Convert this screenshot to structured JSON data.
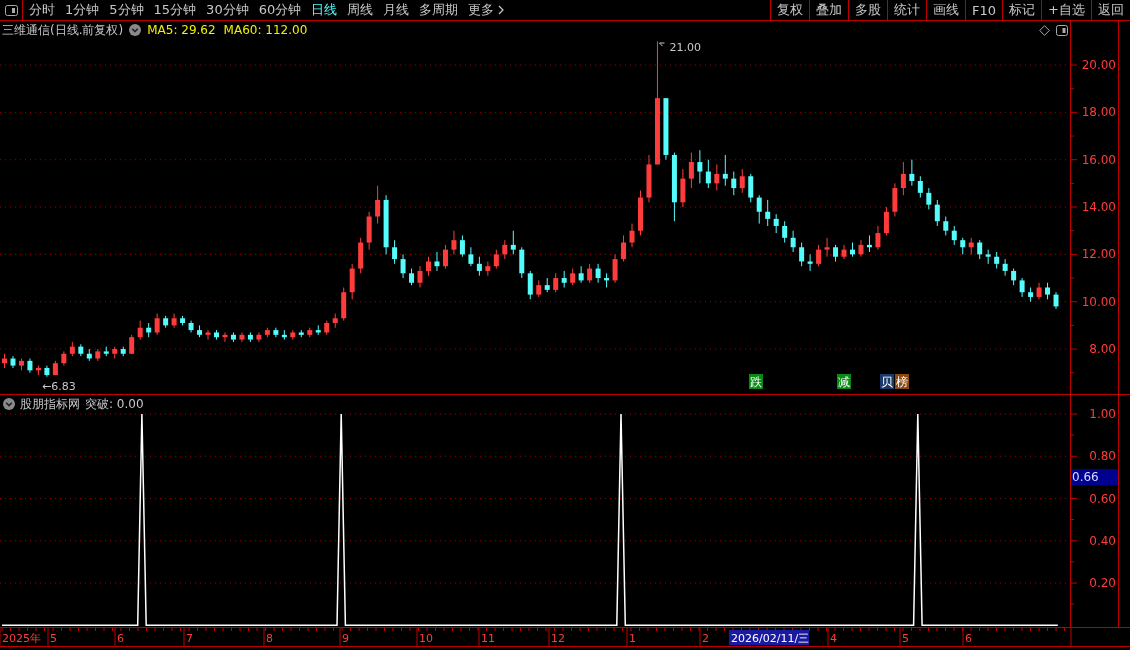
{
  "toolbar": {
    "periods": [
      {
        "label": "分时",
        "selected": false
      },
      {
        "label": "1分钟",
        "selected": false
      },
      {
        "label": "5分钟",
        "selected": false
      },
      {
        "label": "15分钟",
        "selected": false
      },
      {
        "label": "30分钟",
        "selected": false
      },
      {
        "label": "60分钟",
        "selected": false
      },
      {
        "label": "日线",
        "selected": true
      },
      {
        "label": "周线",
        "selected": false
      },
      {
        "label": "月线",
        "selected": false
      },
      {
        "label": "多周期",
        "selected": false
      },
      {
        "label": "更多",
        "selected": false
      }
    ],
    "actions": [
      "复权",
      "叠加",
      "多股",
      "统计",
      "画线",
      "F10",
      "标记",
      "+自选",
      "返回"
    ]
  },
  "price_chart": {
    "title": "三维通信(日线.前复权)",
    "indicators": [
      {
        "label": "MA5: 29.62"
      },
      {
        "label": "MA60: 112.00"
      }
    ],
    "low_label": "←6.83",
    "high_label": "21.00",
    "signals": [
      {
        "label": "跌",
        "color": "#0a8a14"
      },
      {
        "label": "减",
        "color": "#0a8a14"
      },
      {
        "label": "贝",
        "color": "#1a3a6a"
      },
      {
        "label": "榜",
        "color": "#8a4a12"
      }
    ],
    "chart_data": {
      "type": "candlestick",
      "ylim": [
        6.1,
        21.1
      ],
      "grid": true,
      "yticks": [
        {
          "value": 20,
          "label": "20.00"
        },
        {
          "value": 18,
          "label": "18.00"
        },
        {
          "value": 16,
          "label": "16.00"
        },
        {
          "value": 14,
          "label": "14.00"
        },
        {
          "value": 12,
          "label": "12.00"
        },
        {
          "value": 10,
          "label": "10.00"
        },
        {
          "value": 8,
          "label": "8.00"
        }
      ],
      "ohlc": [
        [
          7.4,
          7.8,
          7.2,
          7.6
        ],
        [
          7.6,
          7.7,
          7.2,
          7.3
        ],
        [
          7.3,
          7.6,
          7.1,
          7.5
        ],
        [
          7.5,
          7.6,
          7.0,
          7.1
        ],
        [
          7.1,
          7.3,
          6.9,
          7.2
        ],
        [
          7.2,
          7.3,
          6.83,
          6.9
        ],
        [
          6.9,
          7.5,
          6.9,
          7.4
        ],
        [
          7.4,
          7.9,
          7.3,
          7.8
        ],
        [
          7.8,
          8.3,
          7.7,
          8.1
        ],
        [
          8.1,
          8.2,
          7.7,
          7.8
        ],
        [
          7.8,
          8.0,
          7.5,
          7.6
        ],
        [
          7.6,
          8.0,
          7.5,
          7.9
        ],
        [
          7.9,
          8.1,
          7.7,
          7.8
        ],
        [
          7.8,
          8.1,
          7.6,
          8.0
        ],
        [
          8.0,
          8.1,
          7.7,
          7.8
        ],
        [
          7.8,
          8.6,
          7.8,
          8.5
        ],
        [
          8.5,
          9.2,
          8.4,
          8.9
        ],
        [
          8.9,
          9.1,
          8.5,
          8.7
        ],
        [
          8.7,
          9.5,
          8.6,
          9.3
        ],
        [
          9.3,
          9.4,
          8.9,
          9.0
        ],
        [
          9.0,
          9.5,
          8.9,
          9.3
        ],
        [
          9.3,
          9.4,
          9.0,
          9.1
        ],
        [
          9.1,
          9.2,
          8.7,
          8.8
        ],
        [
          8.8,
          9.0,
          8.5,
          8.6
        ],
        [
          8.6,
          8.8,
          8.4,
          8.7
        ],
        [
          8.7,
          8.8,
          8.4,
          8.5
        ],
        [
          8.5,
          8.7,
          8.3,
          8.6
        ],
        [
          8.6,
          8.7,
          8.3,
          8.4
        ],
        [
          8.4,
          8.7,
          8.3,
          8.6
        ],
        [
          8.6,
          8.7,
          8.3,
          8.4
        ],
        [
          8.4,
          8.7,
          8.3,
          8.6
        ],
        [
          8.6,
          8.9,
          8.5,
          8.8
        ],
        [
          8.8,
          8.9,
          8.5,
          8.6
        ],
        [
          8.6,
          8.8,
          8.4,
          8.5
        ],
        [
          8.5,
          8.8,
          8.4,
          8.7
        ],
        [
          8.7,
          8.8,
          8.5,
          8.6
        ],
        [
          8.6,
          8.9,
          8.5,
          8.8
        ],
        [
          8.8,
          9.0,
          8.6,
          8.7
        ],
        [
          8.7,
          9.2,
          8.6,
          9.1
        ],
        [
          9.1,
          9.5,
          8.9,
          9.3
        ],
        [
          9.3,
          10.6,
          9.2,
          10.4
        ],
        [
          10.4,
          11.6,
          10.1,
          11.4
        ],
        [
          11.4,
          12.7,
          11.2,
          12.5
        ],
        [
          12.5,
          13.8,
          12.2,
          13.6
        ],
        [
          13.6,
          14.9,
          13.3,
          14.3
        ],
        [
          14.3,
          14.5,
          12.0,
          12.3
        ],
        [
          12.3,
          12.6,
          11.6,
          11.8
        ],
        [
          11.8,
          12.0,
          11.0,
          11.2
        ],
        [
          11.2,
          11.4,
          10.7,
          10.8
        ],
        [
          10.8,
          11.5,
          10.6,
          11.3
        ],
        [
          11.3,
          11.9,
          11.1,
          11.7
        ],
        [
          11.7,
          12.1,
          11.3,
          11.5
        ],
        [
          11.5,
          12.4,
          11.4,
          12.2
        ],
        [
          12.2,
          13.0,
          12.0,
          12.6
        ],
        [
          12.6,
          12.8,
          11.9,
          12.0
        ],
        [
          12.0,
          12.3,
          11.5,
          11.6
        ],
        [
          11.6,
          11.9,
          11.1,
          11.3
        ],
        [
          11.3,
          11.7,
          11.1,
          11.5
        ],
        [
          11.5,
          12.2,
          11.4,
          12.0
        ],
        [
          12.0,
          12.6,
          11.8,
          12.4
        ],
        [
          12.4,
          13.0,
          12.0,
          12.2
        ],
        [
          12.2,
          12.3,
          11.0,
          11.2
        ],
        [
          11.2,
          11.3,
          10.1,
          10.3
        ],
        [
          10.3,
          10.9,
          10.2,
          10.7
        ],
        [
          10.7,
          11.0,
          10.4,
          10.5
        ],
        [
          10.5,
          11.2,
          10.4,
          11.0
        ],
        [
          11.0,
          11.3,
          10.6,
          10.8
        ],
        [
          10.8,
          11.4,
          10.7,
          11.2
        ],
        [
          11.2,
          11.5,
          10.8,
          10.9
        ],
        [
          10.9,
          11.6,
          10.8,
          11.4
        ],
        [
          11.4,
          11.6,
          10.8,
          11.0
        ],
        [
          11.0,
          11.2,
          10.6,
          10.9
        ],
        [
          10.9,
          12.0,
          10.8,
          11.8
        ],
        [
          11.8,
          12.8,
          11.7,
          12.5
        ],
        [
          12.5,
          13.3,
          12.3,
          13.0
        ],
        [
          13.0,
          14.7,
          12.8,
          14.4
        ],
        [
          14.4,
          16.2,
          14.2,
          15.8
        ],
        [
          15.8,
          21.0,
          15.8,
          18.6
        ],
        [
          18.6,
          18.6,
          16.0,
          16.2
        ],
        [
          16.2,
          16.3,
          13.4,
          14.2
        ],
        [
          14.2,
          15.6,
          14.0,
          15.2
        ],
        [
          15.2,
          16.3,
          14.8,
          15.9
        ],
        [
          15.9,
          16.4,
          15.0,
          15.5
        ],
        [
          15.5,
          16.0,
          14.8,
          15.0
        ],
        [
          15.0,
          15.8,
          14.7,
          15.4
        ],
        [
          15.4,
          16.2,
          14.9,
          15.2
        ],
        [
          15.2,
          15.5,
          14.5,
          14.8
        ],
        [
          14.8,
          15.6,
          14.6,
          15.3
        ],
        [
          15.3,
          15.4,
          14.2,
          14.4
        ],
        [
          14.4,
          14.5,
          13.3,
          13.8
        ],
        [
          13.8,
          14.3,
          13.2,
          13.5
        ],
        [
          13.5,
          13.7,
          12.9,
          13.2
        ],
        [
          13.2,
          13.4,
          12.5,
          12.7
        ],
        [
          12.7,
          13.0,
          12.1,
          12.3
        ],
        [
          12.3,
          12.5,
          11.5,
          11.7
        ],
        [
          11.7,
          12.0,
          11.3,
          11.6
        ],
        [
          11.6,
          12.4,
          11.5,
          12.2
        ],
        [
          12.2,
          12.7,
          11.9,
          12.3
        ],
        [
          12.3,
          12.4,
          11.7,
          11.9
        ],
        [
          11.9,
          12.4,
          11.8,
          12.2
        ],
        [
          12.2,
          12.5,
          11.9,
          12.0
        ],
        [
          12.0,
          12.6,
          11.9,
          12.4
        ],
        [
          12.4,
          12.8,
          12.1,
          12.3
        ],
        [
          12.3,
          13.2,
          12.2,
          12.9
        ],
        [
          12.9,
          14.0,
          12.8,
          13.8
        ],
        [
          13.8,
          15.0,
          13.6,
          14.8
        ],
        [
          14.8,
          15.9,
          14.5,
          15.4
        ],
        [
          15.4,
          16.0,
          14.9,
          15.1
        ],
        [
          15.1,
          15.3,
          14.4,
          14.6
        ],
        [
          14.6,
          14.8,
          13.9,
          14.1
        ],
        [
          14.1,
          14.3,
          13.2,
          13.4
        ],
        [
          13.4,
          13.6,
          12.8,
          13.0
        ],
        [
          13.0,
          13.2,
          12.4,
          12.6
        ],
        [
          12.6,
          12.7,
          12.0,
          12.3
        ],
        [
          12.3,
          12.7,
          12.0,
          12.5
        ],
        [
          12.5,
          12.6,
          11.8,
          12.0
        ],
        [
          12.0,
          12.2,
          11.6,
          11.9
        ],
        [
          11.9,
          12.1,
          11.4,
          11.6
        ],
        [
          11.6,
          11.8,
          11.1,
          11.3
        ],
        [
          11.3,
          11.4,
          10.7,
          10.9
        ],
        [
          10.9,
          11.0,
          10.2,
          10.4
        ],
        [
          10.4,
          10.6,
          10.0,
          10.2
        ],
        [
          10.2,
          10.8,
          10.1,
          10.6
        ],
        [
          10.6,
          10.8,
          10.1,
          10.3
        ],
        [
          10.3,
          10.4,
          9.7,
          9.8
        ]
      ]
    }
  },
  "signal_panel": {
    "title": "股朋指标网",
    "reading": "突破: 0.00",
    "cursor_value": "0.66",
    "chart_data": {
      "type": "line",
      "ylim": [
        -0.008,
        1.09
      ],
      "grid": true,
      "yticks": [
        {
          "value": 1,
          "label": "1.00"
        },
        {
          "value": 0.8,
          "label": "0.80"
        },
        {
          "value": 0.6,
          "label": "0.60"
        },
        {
          "value": 0.4,
          "label": "0.40"
        },
        {
          "value": 0.2,
          "label": "0.20"
        }
      ],
      "categories": [
        null,
        null,
        null,
        null,
        null,
        null,
        null,
        null,
        null,
        null,
        null,
        null,
        null,
        null,
        null,
        null,
        null,
        null,
        null,
        null,
        null,
        null,
        null,
        null,
        null,
        null,
        null,
        null,
        null,
        null,
        null,
        null,
        null,
        null,
        null,
        null,
        null,
        null,
        null,
        null,
        null,
        null,
        null,
        null,
        null,
        null,
        null,
        null,
        null,
        null,
        null,
        null,
        null,
        null,
        null,
        null,
        null,
        null,
        null,
        null,
        null,
        null,
        null,
        null,
        null,
        null,
        null,
        null,
        null,
        null,
        null,
        null,
        null,
        null,
        null,
        null,
        null,
        null,
        null,
        null,
        null,
        null,
        null,
        null,
        null,
        null,
        null,
        null,
        null,
        null,
        null,
        null,
        null,
        null,
        null,
        null,
        null,
        null,
        null,
        null,
        null,
        null,
        null,
        null,
        null,
        null,
        null,
        null,
        null,
        null,
        null,
        null,
        null,
        null,
        null,
        null,
        null,
        null,
        null,
        null,
        null,
        null,
        null,
        null,
        null,
        null,
        null,
        null,
        null,
        null,
        null,
        null,
        null,
        null,
        null,
        null,
        null,
        null,
        null,
        null,
        null,
        null,
        null,
        null,
        null,
        null,
        null,
        null,
        null,
        null,
        null,
        null,
        null,
        null,
        null,
        null,
        null,
        null,
        null,
        null,
        null,
        null,
        null,
        null,
        null,
        null,
        null,
        null,
        null,
        null,
        null,
        null,
        null,
        null,
        null,
        null,
        null,
        null,
        null,
        null,
        null,
        null,
        null,
        null,
        null,
        null,
        null,
        null,
        null,
        null,
        null,
        null,
        null,
        null,
        null,
        null,
        null,
        null,
        null,
        null,
        null,
        null,
        null,
        null,
        null,
        null,
        null,
        null,
        null,
        null,
        null,
        null,
        null,
        null,
        null,
        null,
        null,
        null,
        null,
        null,
        null,
        null,
        null,
        null,
        null,
        null,
        null,
        null,
        null,
        null,
        null,
        null,
        null,
        null,
        null,
        null,
        null,
        null,
        null,
        null,
        null,
        null,
        null,
        null,
        null,
        null,
        null,
        null,
        null,
        null
      ],
      "series": [
        {
          "color": "#ffffff",
          "values": [
            0,
            0,
            0,
            0,
            0,
            0,
            0,
            0,
            0,
            0,
            0,
            0,
            0,
            0,
            0,
            0,
            0,
            0,
            0,
            0,
            0,
            0,
            0,
            0,
            0,
            0,
            0,
            0,
            0,
            0,
            0,
            0,
            0,
            1,
            0,
            0,
            0,
            0,
            0,
            0,
            0,
            0,
            0,
            0,
            0,
            0,
            0,
            0,
            0,
            0,
            0,
            0,
            0,
            0,
            0,
            0,
            0,
            0,
            0,
            0,
            0,
            0,
            0,
            0,
            0,
            0,
            0,
            0,
            0,
            0,
            0,
            0,
            0,
            0,
            0,
            0,
            0,
            0,
            0,
            0,
            1,
            0,
            0,
            0,
            0,
            0,
            0,
            0,
            0,
            0,
            0,
            0,
            0,
            0,
            0,
            0,
            0,
            0,
            0,
            0,
            0,
            0,
            0,
            0,
            0,
            0,
            0,
            0,
            0,
            0,
            0,
            0,
            0,
            0,
            0,
            0,
            0,
            0,
            0,
            0,
            0,
            0,
            0,
            0,
            0,
            0,
            0,
            0,
            0,
            0,
            0,
            0,
            0,
            0,
            0,
            0,
            0,
            0,
            0,
            0,
            0,
            0,
            0,
            0,
            0,
            0,
            1,
            0,
            0,
            0,
            0,
            0,
            0,
            0,
            0,
            0,
            0,
            0,
            0,
            0,
            0,
            0,
            0,
            0,
            0,
            0,
            0,
            0,
            0,
            0,
            0,
            0,
            0,
            0,
            0,
            0,
            0,
            0,
            0,
            0,
            0,
            0,
            0,
            0,
            0,
            0,
            0,
            0,
            0,
            0,
            0,
            0,
            0,
            0,
            0,
            0,
            0,
            0,
            0,
            0,
            0,
            0,
            0,
            0,
            0,
            0,
            0,
            0,
            0,
            0,
            0,
            0,
            0,
            0,
            0,
            0,
            1,
            0,
            0,
            0,
            0,
            0,
            0,
            0,
            0,
            0,
            0,
            0,
            0,
            0,
            0,
            0,
            0,
            0,
            0,
            0,
            0,
            0,
            0,
            0,
            0,
            0,
            0,
            0,
            0,
            0,
            0,
            0,
            0,
            0
          ]
        }
      ]
    }
  },
  "date_axis": {
    "labels": [
      {
        "label": "2025年",
        "highlighted": false
      },
      {
        "label": "5",
        "highlighted": false
      },
      {
        "label": "6",
        "highlighted": false
      },
      {
        "label": "7",
        "highlighted": false
      },
      {
        "label": "8",
        "highlighted": false
      },
      {
        "label": "9",
        "highlighted": false
      },
      {
        "label": "10",
        "highlighted": false
      },
      {
        "label": "11",
        "highlighted": false
      },
      {
        "label": "12",
        "highlighted": false
      },
      {
        "label": "1",
        "highlighted": false
      },
      {
        "label": "2",
        "highlighted": false
      },
      {
        "label": "2026/02/11/三",
        "highlighted": true
      },
      {
        "label": "4",
        "highlighted": false
      },
      {
        "label": "5",
        "highlighted": false
      },
      {
        "label": "6",
        "highlighted": false
      }
    ]
  }
}
